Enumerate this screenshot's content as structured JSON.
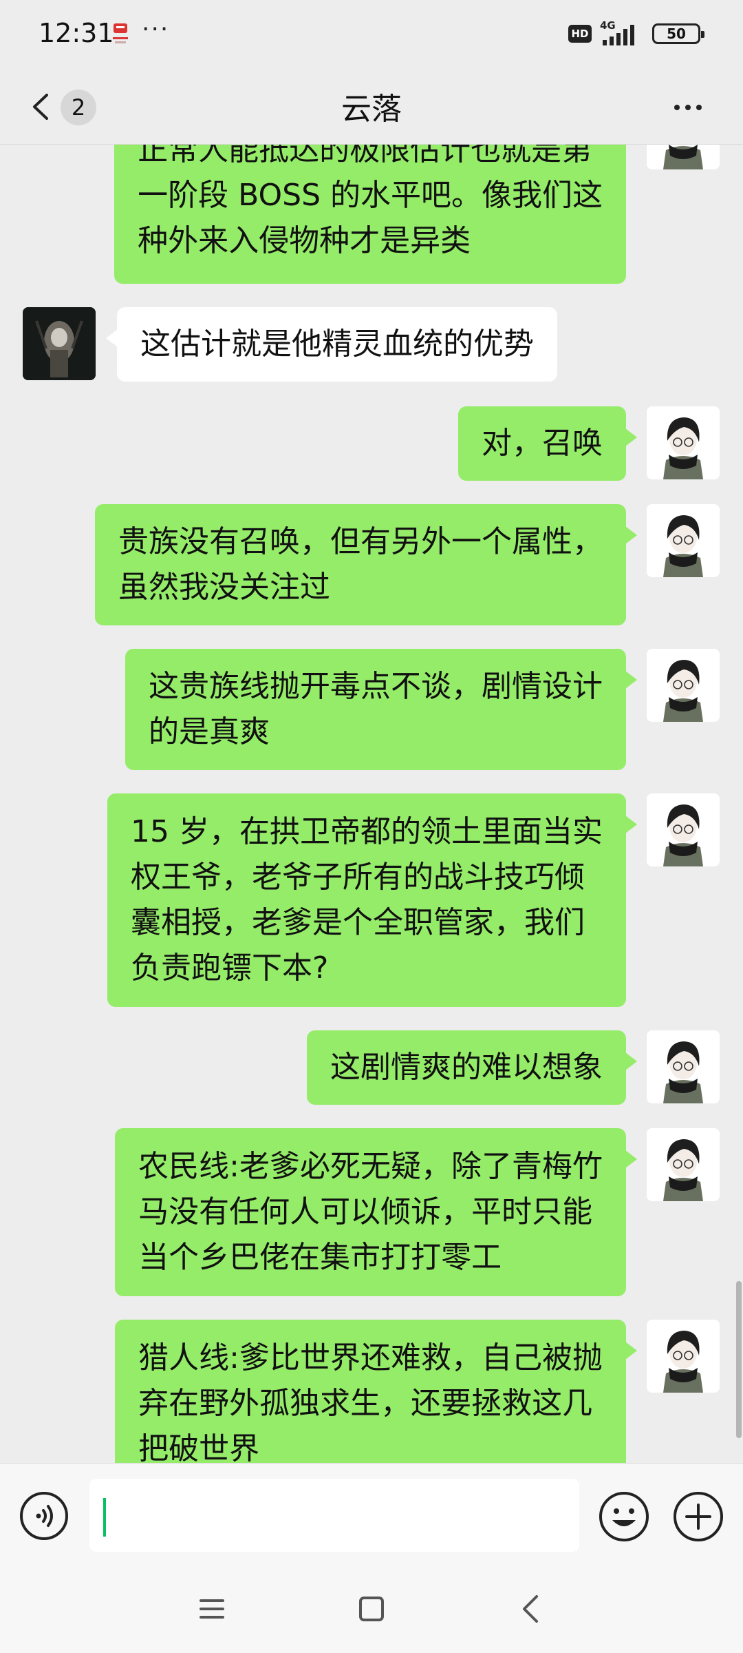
{
  "status_bar": {
    "time": "12:31",
    "dots": "···",
    "hd": "HD",
    "network": "4G",
    "battery": "50"
  },
  "header": {
    "back_count": "2",
    "title": "云落"
  },
  "messages": [
    {
      "sender": "me",
      "text": "正常人能抵达的极限估计也就是第\n一阶段 BOSS 的水平吧。像我们这\n种外来入侵物种才是异类"
    },
    {
      "sender": "other",
      "text": "这估计就是他精灵血统的优势"
    },
    {
      "sender": "me",
      "text": "对，召唤"
    },
    {
      "sender": "me",
      "text": "贵族没有召唤，但有另外一个属性，\n虽然我没关注过"
    },
    {
      "sender": "me",
      "text": "这贵族线抛开毒点不谈，剧情设计\n的是真爽"
    },
    {
      "sender": "me",
      "text": "15 岁，在拱卫帝都的领土里面当实\n权王爷，老爷子所有的战斗技巧倾\n囊相授，老爹是个全职管家，我们\n负责跑镖下本?"
    },
    {
      "sender": "me",
      "text": "这剧情爽的难以想象"
    },
    {
      "sender": "me",
      "text": "农民线:老爹必死无疑，除了青梅竹\n马没有任何人可以倾诉，平时只能\n当个乡巴佬在集市打打零工"
    },
    {
      "sender": "me",
      "text": "猎人线:爹比世界还难救，自己被抛\n弃在野外孤独求生，还要拯救这几\n把破世界"
    }
  ],
  "colors": {
    "background": "#ededed",
    "bubble_me": "#95ec69",
    "bubble_other": "#ffffff",
    "caret": "#07c160"
  },
  "icons": [
    "back-icon",
    "more-icon",
    "voice-icon",
    "emoji-icon",
    "plus-icon",
    "menu-icon",
    "home-icon",
    "nav-back-icon"
  ]
}
